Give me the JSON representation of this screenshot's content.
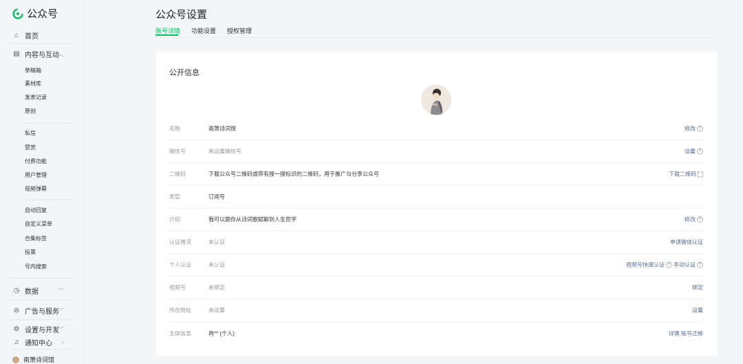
{
  "brand": {
    "name": "公众号",
    "accent": "#07c160",
    "link_color": "#576b95"
  },
  "sidebar": {
    "home": "首页",
    "content_group": "内容与互动",
    "content_items": [
      "草稿箱",
      "素材库",
      "发表记录",
      "原创"
    ],
    "interact_items": [
      "私信",
      "赞赏",
      "付费功能",
      "用户管理",
      "视频弹幕"
    ],
    "menu_items": [
      "自动回复",
      "自定义菜单",
      "合集标签",
      "投票",
      "号内搜索"
    ],
    "data": "数据",
    "ads": "广告与服务",
    "settings": "设置与开发",
    "notify": "通知中心",
    "account": "南箫诗词馆"
  },
  "header": {
    "title": "公众号设置",
    "tabs": [
      "账号详情",
      "功能设置",
      "授权管理"
    ]
  },
  "card": {
    "title": "公开信息",
    "rows": [
      {
        "label": "名称",
        "value": "南箫诗词馆",
        "action": "修改"
      },
      {
        "label": "微信号",
        "value": "未设置微信号",
        "action": "设置"
      },
      {
        "label": "二维码",
        "value": "下载公众号二维码或带有搜一搜标识的二维码，用于推广与分享公众号",
        "action": "下载二维码"
      },
      {
        "label": "类型",
        "value": "订阅号",
        "action": ""
      },
      {
        "label": "介绍",
        "value": "我可以跟你从诗词歌赋聊到人生哲学",
        "action": "修改"
      },
      {
        "label": "认证情况",
        "value": "未认证",
        "action": "申请微信认证"
      },
      {
        "label": "个人认证",
        "value": "未认证",
        "action": "视频号快速认证",
        "action2": "手动认证"
      },
      {
        "label": "视频号",
        "value": "未绑定",
        "action": "绑定"
      },
      {
        "label": "所在地址",
        "value": "未设置",
        "action": "设置"
      },
      {
        "label": "主体信息",
        "value": "冉** (个人)",
        "action": "详情 账号迁移"
      }
    ]
  }
}
